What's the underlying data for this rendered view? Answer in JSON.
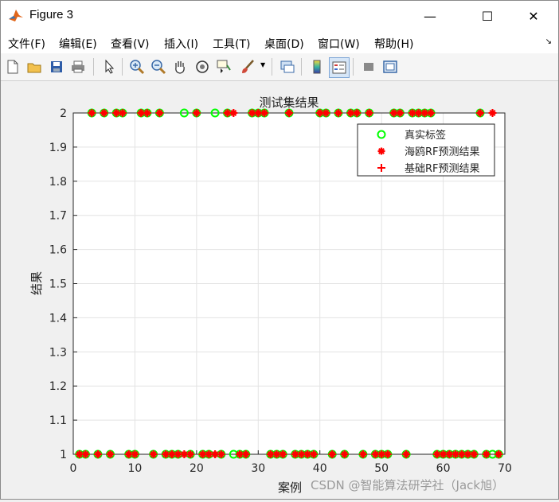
{
  "window": {
    "title": "Figure 3",
    "minimize_glyph": "—",
    "maximize_glyph": "☐",
    "close_glyph": "✕"
  },
  "menu": {
    "items": [
      "文件(F)",
      "编辑(E)",
      "查看(V)",
      "插入(I)",
      "工具(T)",
      "桌面(D)",
      "窗口(W)",
      "帮助(H)"
    ],
    "overflow_glyph": "↘"
  },
  "toolbar": {
    "icons": [
      "new-figure-icon",
      "open-file-icon",
      "save-icon",
      "print-icon",
      "edit-plot-icon",
      "zoom-in-icon",
      "zoom-out-icon",
      "pan-icon",
      "rotate-3d-icon",
      "data-cursor-icon",
      "brush-icon",
      "link-plot-icon",
      "colorbar-icon",
      "legend-icon",
      "hide-tools-icon",
      "show-tools-icon"
    ]
  },
  "chart_data": {
    "type": "scatter",
    "title": "测试集结果",
    "xlabel": "案例",
    "ylabel": "结果",
    "xlim": [
      0,
      70
    ],
    "ylim": [
      1,
      2
    ],
    "xticks": [
      "0",
      "10",
      "20",
      "30",
      "40",
      "50",
      "60",
      "70"
    ],
    "yticks": [
      "1",
      "1.1",
      "1.2",
      "1.3",
      "1.4",
      "1.5",
      "1.6",
      "1.7",
      "1.8",
      "1.9",
      "2"
    ],
    "grid": true,
    "legend_position": "top-right",
    "colors": {
      "true_label": "#00ff00",
      "predicted": "#ff0000"
    },
    "series": [
      {
        "name": "真实标签",
        "marker": "o",
        "color": "#00ff00",
        "points": [
          [
            1,
            1
          ],
          [
            2,
            1
          ],
          [
            3,
            2
          ],
          [
            4,
            1
          ],
          [
            5,
            2
          ],
          [
            6,
            1
          ],
          [
            7,
            2
          ],
          [
            8,
            2
          ],
          [
            9,
            1
          ],
          [
            10,
            1
          ],
          [
            11,
            2
          ],
          [
            12,
            2
          ],
          [
            13,
            1
          ],
          [
            14,
            2
          ],
          [
            15,
            1
          ],
          [
            16,
            1
          ],
          [
            17,
            1
          ],
          [
            18,
            2
          ],
          [
            19,
            1
          ],
          [
            20,
            2
          ],
          [
            21,
            1
          ],
          [
            22,
            1
          ],
          [
            23,
            2
          ],
          [
            24,
            1
          ],
          [
            25,
            2
          ],
          [
            26,
            1
          ],
          [
            27,
            1
          ],
          [
            28,
            1
          ],
          [
            29,
            2
          ],
          [
            30,
            2
          ],
          [
            31,
            2
          ],
          [
            32,
            1
          ],
          [
            33,
            1
          ],
          [
            34,
            1
          ],
          [
            35,
            2
          ],
          [
            36,
            1
          ],
          [
            37,
            1
          ],
          [
            38,
            1
          ],
          [
            39,
            1
          ],
          [
            40,
            2
          ],
          [
            41,
            2
          ],
          [
            42,
            1
          ],
          [
            43,
            2
          ],
          [
            44,
            1
          ],
          [
            45,
            2
          ],
          [
            46,
            2
          ],
          [
            47,
            1
          ],
          [
            48,
            2
          ],
          [
            49,
            1
          ],
          [
            50,
            1
          ],
          [
            51,
            1
          ],
          [
            52,
            2
          ],
          [
            53,
            2
          ],
          [
            54,
            1
          ],
          [
            55,
            2
          ],
          [
            56,
            2
          ],
          [
            57,
            2
          ],
          [
            58,
            2
          ],
          [
            59,
            1
          ],
          [
            60,
            1
          ],
          [
            61,
            1
          ],
          [
            62,
            1
          ],
          [
            63,
            1
          ],
          [
            64,
            1
          ],
          [
            65,
            1
          ],
          [
            66,
            2
          ],
          [
            67,
            1
          ],
          [
            68,
            1
          ],
          [
            69,
            1
          ]
        ]
      },
      {
        "name": "海鸥RF预测结果",
        "marker": "*",
        "color": "#ff0000",
        "points": [
          [
            1,
            1
          ],
          [
            2,
            1
          ],
          [
            3,
            2
          ],
          [
            4,
            1
          ],
          [
            5,
            2
          ],
          [
            6,
            1
          ],
          [
            7,
            2
          ],
          [
            8,
            2
          ],
          [
            9,
            1
          ],
          [
            10,
            1
          ],
          [
            11,
            2
          ],
          [
            12,
            2
          ],
          [
            13,
            1
          ],
          [
            14,
            2
          ],
          [
            15,
            1
          ],
          [
            16,
            1
          ],
          [
            17,
            1
          ],
          [
            18,
            1
          ],
          [
            19,
            1
          ],
          [
            20,
            2
          ],
          [
            21,
            1
          ],
          [
            22,
            1
          ],
          [
            23,
            1
          ],
          [
            24,
            1
          ],
          [
            25,
            2
          ],
          [
            26,
            2
          ],
          [
            27,
            1
          ],
          [
            28,
            1
          ],
          [
            29,
            2
          ],
          [
            30,
            2
          ],
          [
            31,
            2
          ],
          [
            32,
            1
          ],
          [
            33,
            1
          ],
          [
            34,
            1
          ],
          [
            35,
            2
          ],
          [
            36,
            1
          ],
          [
            37,
            1
          ],
          [
            38,
            1
          ],
          [
            39,
            1
          ],
          [
            40,
            2
          ],
          [
            41,
            2
          ],
          [
            42,
            1
          ],
          [
            43,
            2
          ],
          [
            44,
            1
          ],
          [
            45,
            2
          ],
          [
            46,
            2
          ],
          [
            47,
            1
          ],
          [
            48,
            2
          ],
          [
            49,
            1
          ],
          [
            50,
            1
          ],
          [
            51,
            1
          ],
          [
            52,
            2
          ],
          [
            53,
            2
          ],
          [
            54,
            1
          ],
          [
            55,
            2
          ],
          [
            56,
            2
          ],
          [
            57,
            2
          ],
          [
            58,
            2
          ],
          [
            59,
            1
          ],
          [
            60,
            1
          ],
          [
            61,
            1
          ],
          [
            62,
            1
          ],
          [
            63,
            1
          ],
          [
            64,
            1
          ],
          [
            65,
            1
          ],
          [
            66,
            2
          ],
          [
            67,
            1
          ],
          [
            68,
            2
          ],
          [
            69,
            1
          ]
        ]
      },
      {
        "name": "基础RF预测结果",
        "marker": "+",
        "color": "#ff0000",
        "points": [
          [
            1,
            1
          ],
          [
            2,
            1
          ],
          [
            3,
            2
          ],
          [
            4,
            1
          ],
          [
            5,
            2
          ],
          [
            6,
            1
          ],
          [
            7,
            2
          ],
          [
            8,
            2
          ],
          [
            9,
            1
          ],
          [
            10,
            1
          ],
          [
            11,
            2
          ],
          [
            12,
            2
          ],
          [
            13,
            1
          ],
          [
            14,
            2
          ],
          [
            15,
            1
          ],
          [
            16,
            1
          ],
          [
            17,
            1
          ],
          [
            18,
            1
          ],
          [
            19,
            1
          ],
          [
            20,
            2
          ],
          [
            21,
            1
          ],
          [
            22,
            1
          ],
          [
            23,
            1
          ],
          [
            24,
            1
          ],
          [
            25,
            2
          ],
          [
            26,
            2
          ],
          [
            27,
            1
          ],
          [
            28,
            1
          ],
          [
            29,
            2
          ],
          [
            30,
            2
          ],
          [
            31,
            2
          ],
          [
            32,
            1
          ],
          [
            33,
            1
          ],
          [
            34,
            1
          ],
          [
            35,
            2
          ],
          [
            36,
            1
          ],
          [
            37,
            1
          ],
          [
            38,
            1
          ],
          [
            39,
            1
          ],
          [
            40,
            2
          ],
          [
            41,
            2
          ],
          [
            42,
            1
          ],
          [
            43,
            2
          ],
          [
            44,
            1
          ],
          [
            45,
            2
          ],
          [
            46,
            2
          ],
          [
            47,
            1
          ],
          [
            48,
            2
          ],
          [
            49,
            1
          ],
          [
            50,
            1
          ],
          [
            51,
            1
          ],
          [
            52,
            2
          ],
          [
            53,
            2
          ],
          [
            54,
            1
          ],
          [
            55,
            2
          ],
          [
            56,
            2
          ],
          [
            57,
            2
          ],
          [
            58,
            2
          ],
          [
            59,
            1
          ],
          [
            60,
            1
          ],
          [
            61,
            1
          ],
          [
            62,
            1
          ],
          [
            63,
            1
          ],
          [
            64,
            1
          ],
          [
            65,
            1
          ],
          [
            66,
            2
          ],
          [
            67,
            1
          ],
          [
            68,
            2
          ],
          [
            69,
            1
          ]
        ]
      }
    ]
  },
  "watermark": "CSDN @智能算法研学社（Jack旭）"
}
